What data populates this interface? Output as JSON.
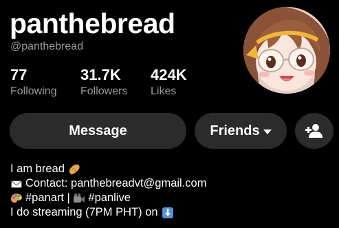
{
  "profile": {
    "display_name": "panthebread",
    "handle": "@panthebread",
    "stats": [
      {
        "value": "77",
        "label": "Following"
      },
      {
        "value": "31.7K",
        "label": "Followers"
      },
      {
        "value": "424K",
        "label": "Likes"
      }
    ],
    "avatar_icon": "anime-girl-avatar"
  },
  "actions": {
    "message_label": "Message",
    "friends_label": "Friends",
    "add_friend_icon": "add-person-icon"
  },
  "bio": {
    "line1": "I am bread",
    "line1_icon": "bread-emoji",
    "line2": "Contact: panthebreadvt@gmail.com",
    "line2_icon": "envelope-emoji",
    "line3_part1": "#panart | ",
    "line3_part2": "#panlive",
    "line3_icon1": "palette-emoji",
    "line3_icon2": "camera-emoji",
    "line4": "I do streaming (7PM PHT) on",
    "line4_icon": "down-arrow-emoji"
  },
  "colors": {
    "background": "#000000",
    "button": "#2b2b2b",
    "secondary_text": "#9a9a9a"
  }
}
